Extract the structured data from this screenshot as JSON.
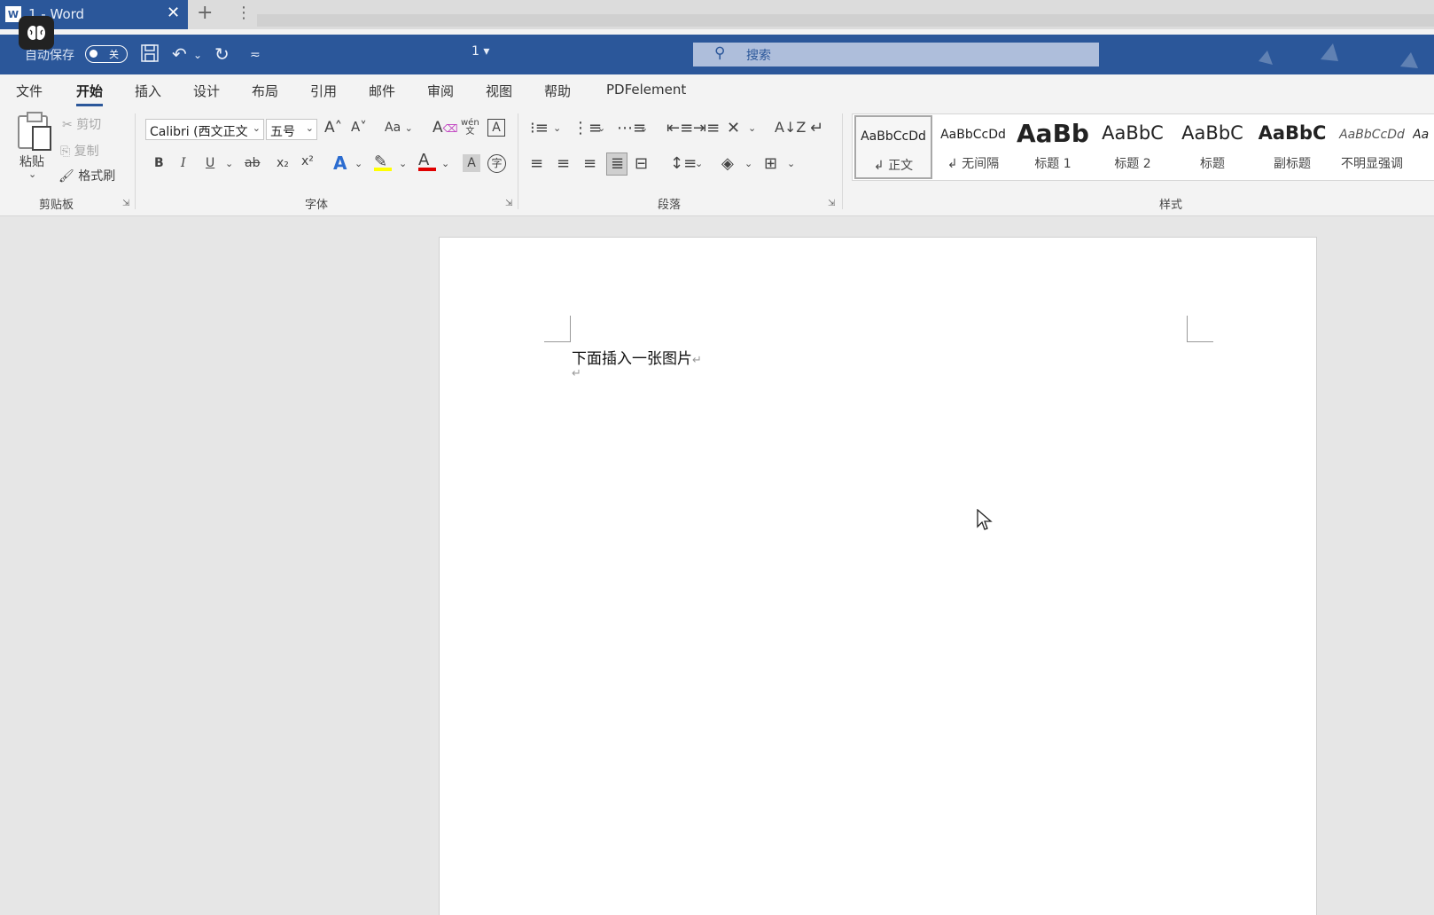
{
  "browser": {
    "tab_icon": "W",
    "tab_title": "1 - Word",
    "close": "✕",
    "new_tab": "+",
    "menu": "⋮"
  },
  "titlebar": {
    "autosave_label": "自动保存",
    "toggle_state": "关",
    "doc_name": "1 ▾",
    "search_placeholder": "搜索"
  },
  "menu": [
    "文件",
    "开始",
    "插入",
    "设计",
    "布局",
    "引用",
    "邮件",
    "审阅",
    "视图",
    "帮助",
    "PDFelement"
  ],
  "menu_active": "开始",
  "clipboard": {
    "paste": "粘贴",
    "cut": "剪切",
    "copy": "复制",
    "format_painter": "格式刷",
    "group": "剪贴板"
  },
  "font": {
    "font_name": "Calibri (西文正文",
    "font_size": "五号",
    "group": "字体",
    "grow": "A˄",
    "shrink": "A˅",
    "case": "Aa",
    "bold": "B",
    "italic": "I",
    "underline": "U",
    "strike": "ab",
    "subscript": "x₂",
    "superscript": "x²",
    "effects": "A",
    "font_color": "A",
    "char_shading": "A",
    "phonetic": "wén",
    "enclose": "字",
    "border_char": "A"
  },
  "paragraph": {
    "group": "段落"
  },
  "styles": {
    "group": "样式",
    "items": [
      {
        "sample": "AaBbCcDd",
        "name": "↲ 正文"
      },
      {
        "sample": "AaBbCcDd",
        "name": "↲ 无间隔"
      },
      {
        "sample": "AaBb",
        "name": "标题 1"
      },
      {
        "sample": "AaBbC",
        "name": "标题 2"
      },
      {
        "sample": "AaBbC",
        "name": "标题"
      },
      {
        "sample": "AaBbC",
        "name": "副标题"
      },
      {
        "sample": "AaBbCcDd",
        "name": "不明显强调"
      },
      {
        "sample": "Aa",
        "name": ""
      }
    ]
  },
  "document": {
    "line1": "下面插入一张图片",
    "para_mark": "↵"
  },
  "colors": {
    "accent": "#2b579a",
    "highlight": "#ffff00",
    "font_red": "#e00000"
  }
}
